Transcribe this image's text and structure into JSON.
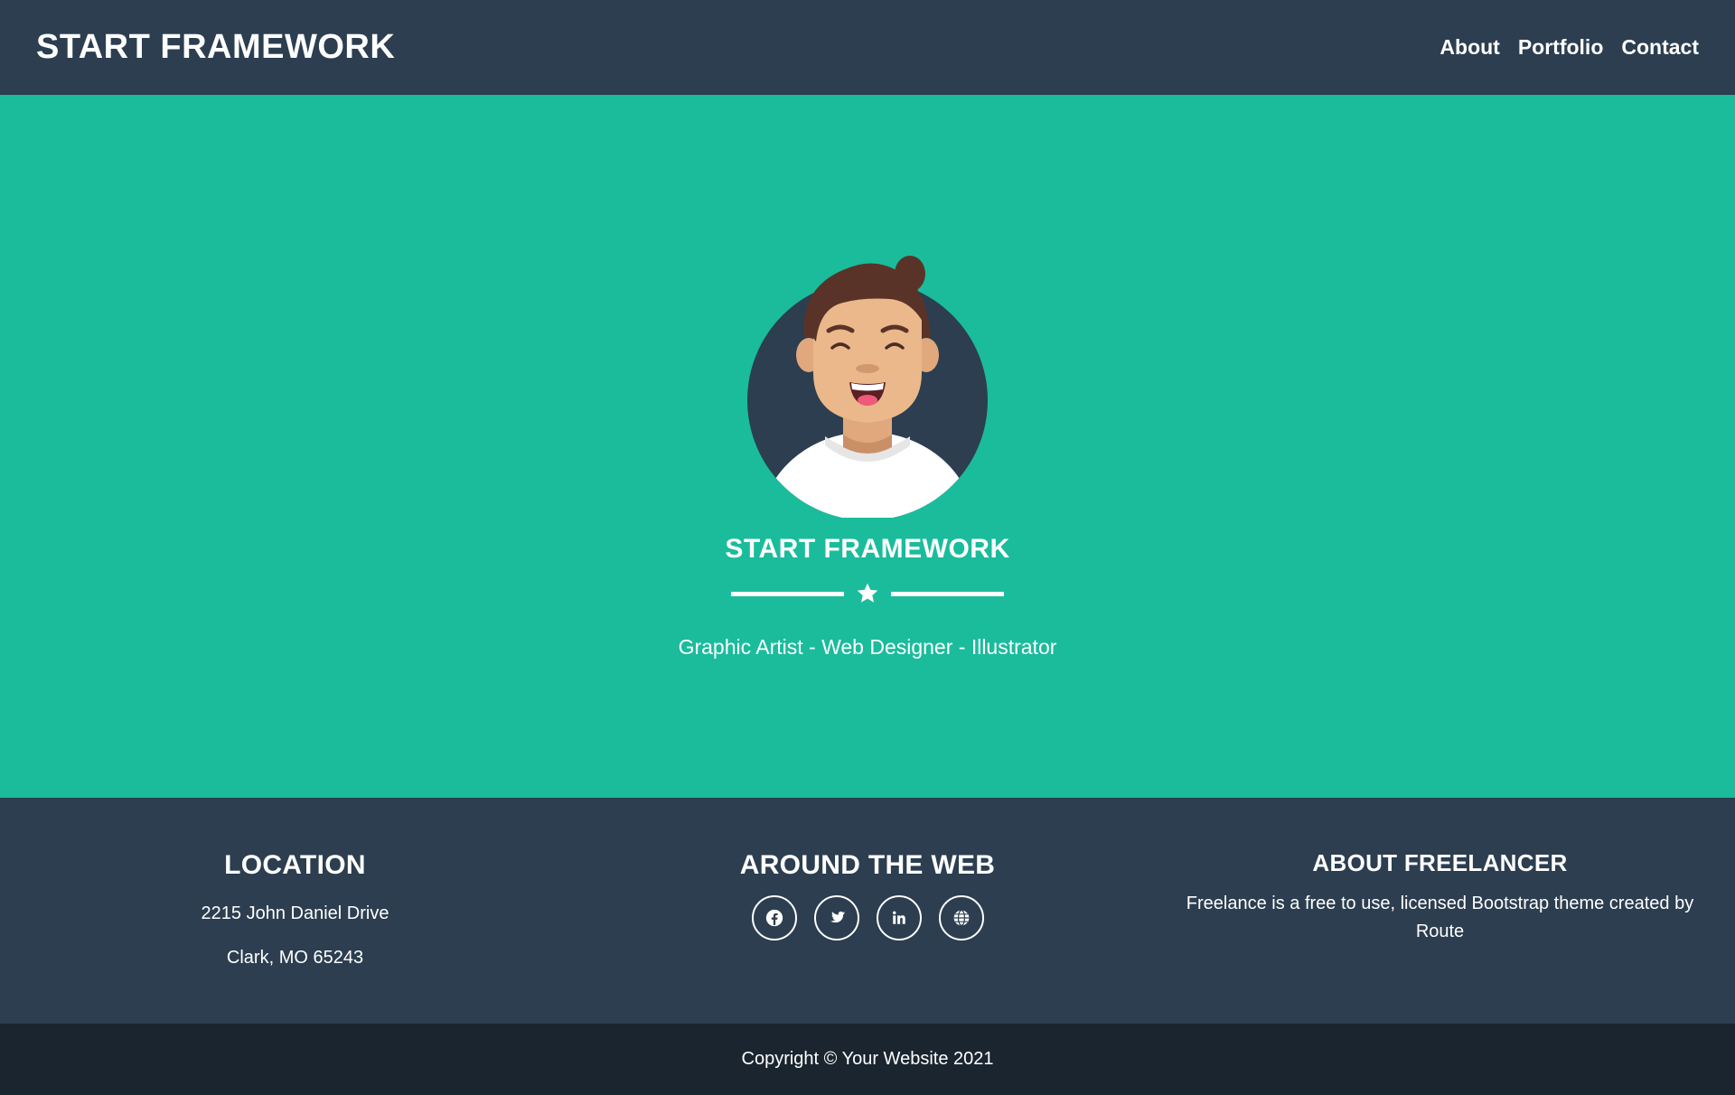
{
  "navbar": {
    "brand": "START FRAMEWORK",
    "links": [
      "About",
      "Portfolio",
      "Contact"
    ]
  },
  "hero": {
    "title": "START FRAMEWORK",
    "subtitle": "Graphic Artist - Web Designer - Illustrator"
  },
  "footer": {
    "location": {
      "heading": "LOCATION",
      "line1": "2215 John Daniel Drive",
      "line2": "Clark, MO 65243"
    },
    "web": {
      "heading": "AROUND THE WEB",
      "icons": [
        "facebook-icon",
        "twitter-icon",
        "linkedin-icon",
        "globe-icon"
      ]
    },
    "about": {
      "heading": "ABOUT FREELANCER",
      "text": "Freelance is a free to use, licensed Bootstrap theme created by Route"
    }
  },
  "copyright": "Copyright © Your Website 2021",
  "colors": {
    "navbar": "#2c3e50",
    "hero": "#1abc9c",
    "footer": "#2c3e50",
    "copyright_bar": "#1a252f"
  }
}
